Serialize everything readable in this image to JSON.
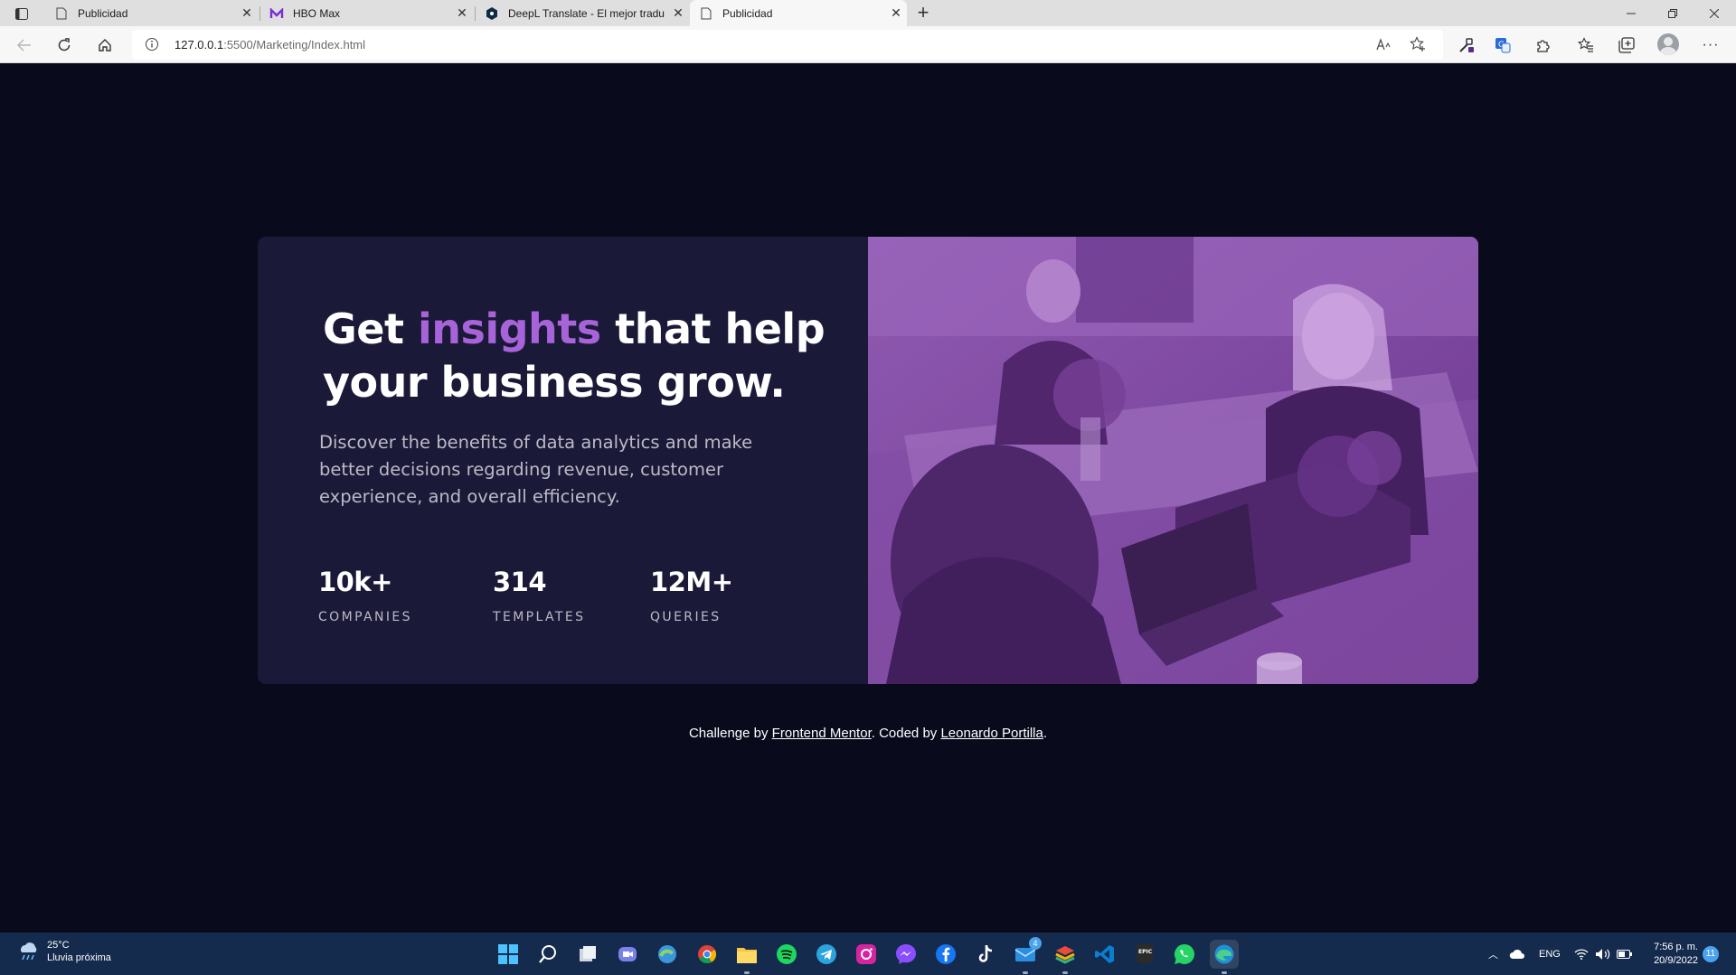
{
  "browser": {
    "tabs": [
      {
        "label": "Publicidad",
        "icon": "page-icon",
        "active": false
      },
      {
        "label": "HBO Max",
        "icon": "hbo-max-icon",
        "active": false
      },
      {
        "label": "DeepL Translate - El mejor tradu",
        "icon": "deepl-icon",
        "active": false
      },
      {
        "label": "Publicidad",
        "icon": "page-icon",
        "active": true
      }
    ],
    "new_tab": "+",
    "close_glyph": "✕",
    "address": {
      "host": "127.0.0.1",
      "path": ":5500/Marketing/Index.html"
    },
    "window_controls": {
      "minimize": "—",
      "restore": "❐",
      "close": "✕"
    }
  },
  "hero": {
    "headline_start": "Get ",
    "headline_accent": "insights",
    "headline_end": " that help your business grow.",
    "description": "Discover the benefits of data analytics and make better decisions regarding revenue, customer experience, and overall efficiency.",
    "stats": [
      {
        "value": "10k+",
        "label": "COMPANIES"
      },
      {
        "value": "314",
        "label": "TEMPLATES"
      },
      {
        "value": "12M+",
        "label": "QUERIES"
      }
    ],
    "accent_color": "#a763d8",
    "card_color": "#1b1938",
    "page_color": "#090b1d",
    "image_tint": "#aa5cdb"
  },
  "attribution": {
    "prefix": "Challenge by ",
    "link1": "Frontend Mentor",
    "middle": ". Coded by ",
    "link2": "Leonardo Portilla",
    "suffix": "."
  },
  "taskbar": {
    "weather": {
      "temp": "25°C",
      "condition": "Lluvia próxima"
    },
    "apps": [
      "windows-start-icon",
      "search-icon",
      "task-view-icon",
      "teams-chat-icon",
      "edge-dev-icon",
      "chrome-icon",
      "file-explorer-icon",
      "spotify-icon",
      "telegram-icon",
      "instagram-icon",
      "messenger-icon",
      "facebook-icon",
      "tiktok-icon",
      "mail-icon",
      "bluestacks-icon",
      "vscode-icon",
      "epic-games-icon",
      "whatsapp-icon",
      "edge-icon"
    ],
    "mail_badge": "4",
    "language": "ENG",
    "time": "7:56 p. m.",
    "date": "20/9/2022",
    "notifications": "11"
  }
}
